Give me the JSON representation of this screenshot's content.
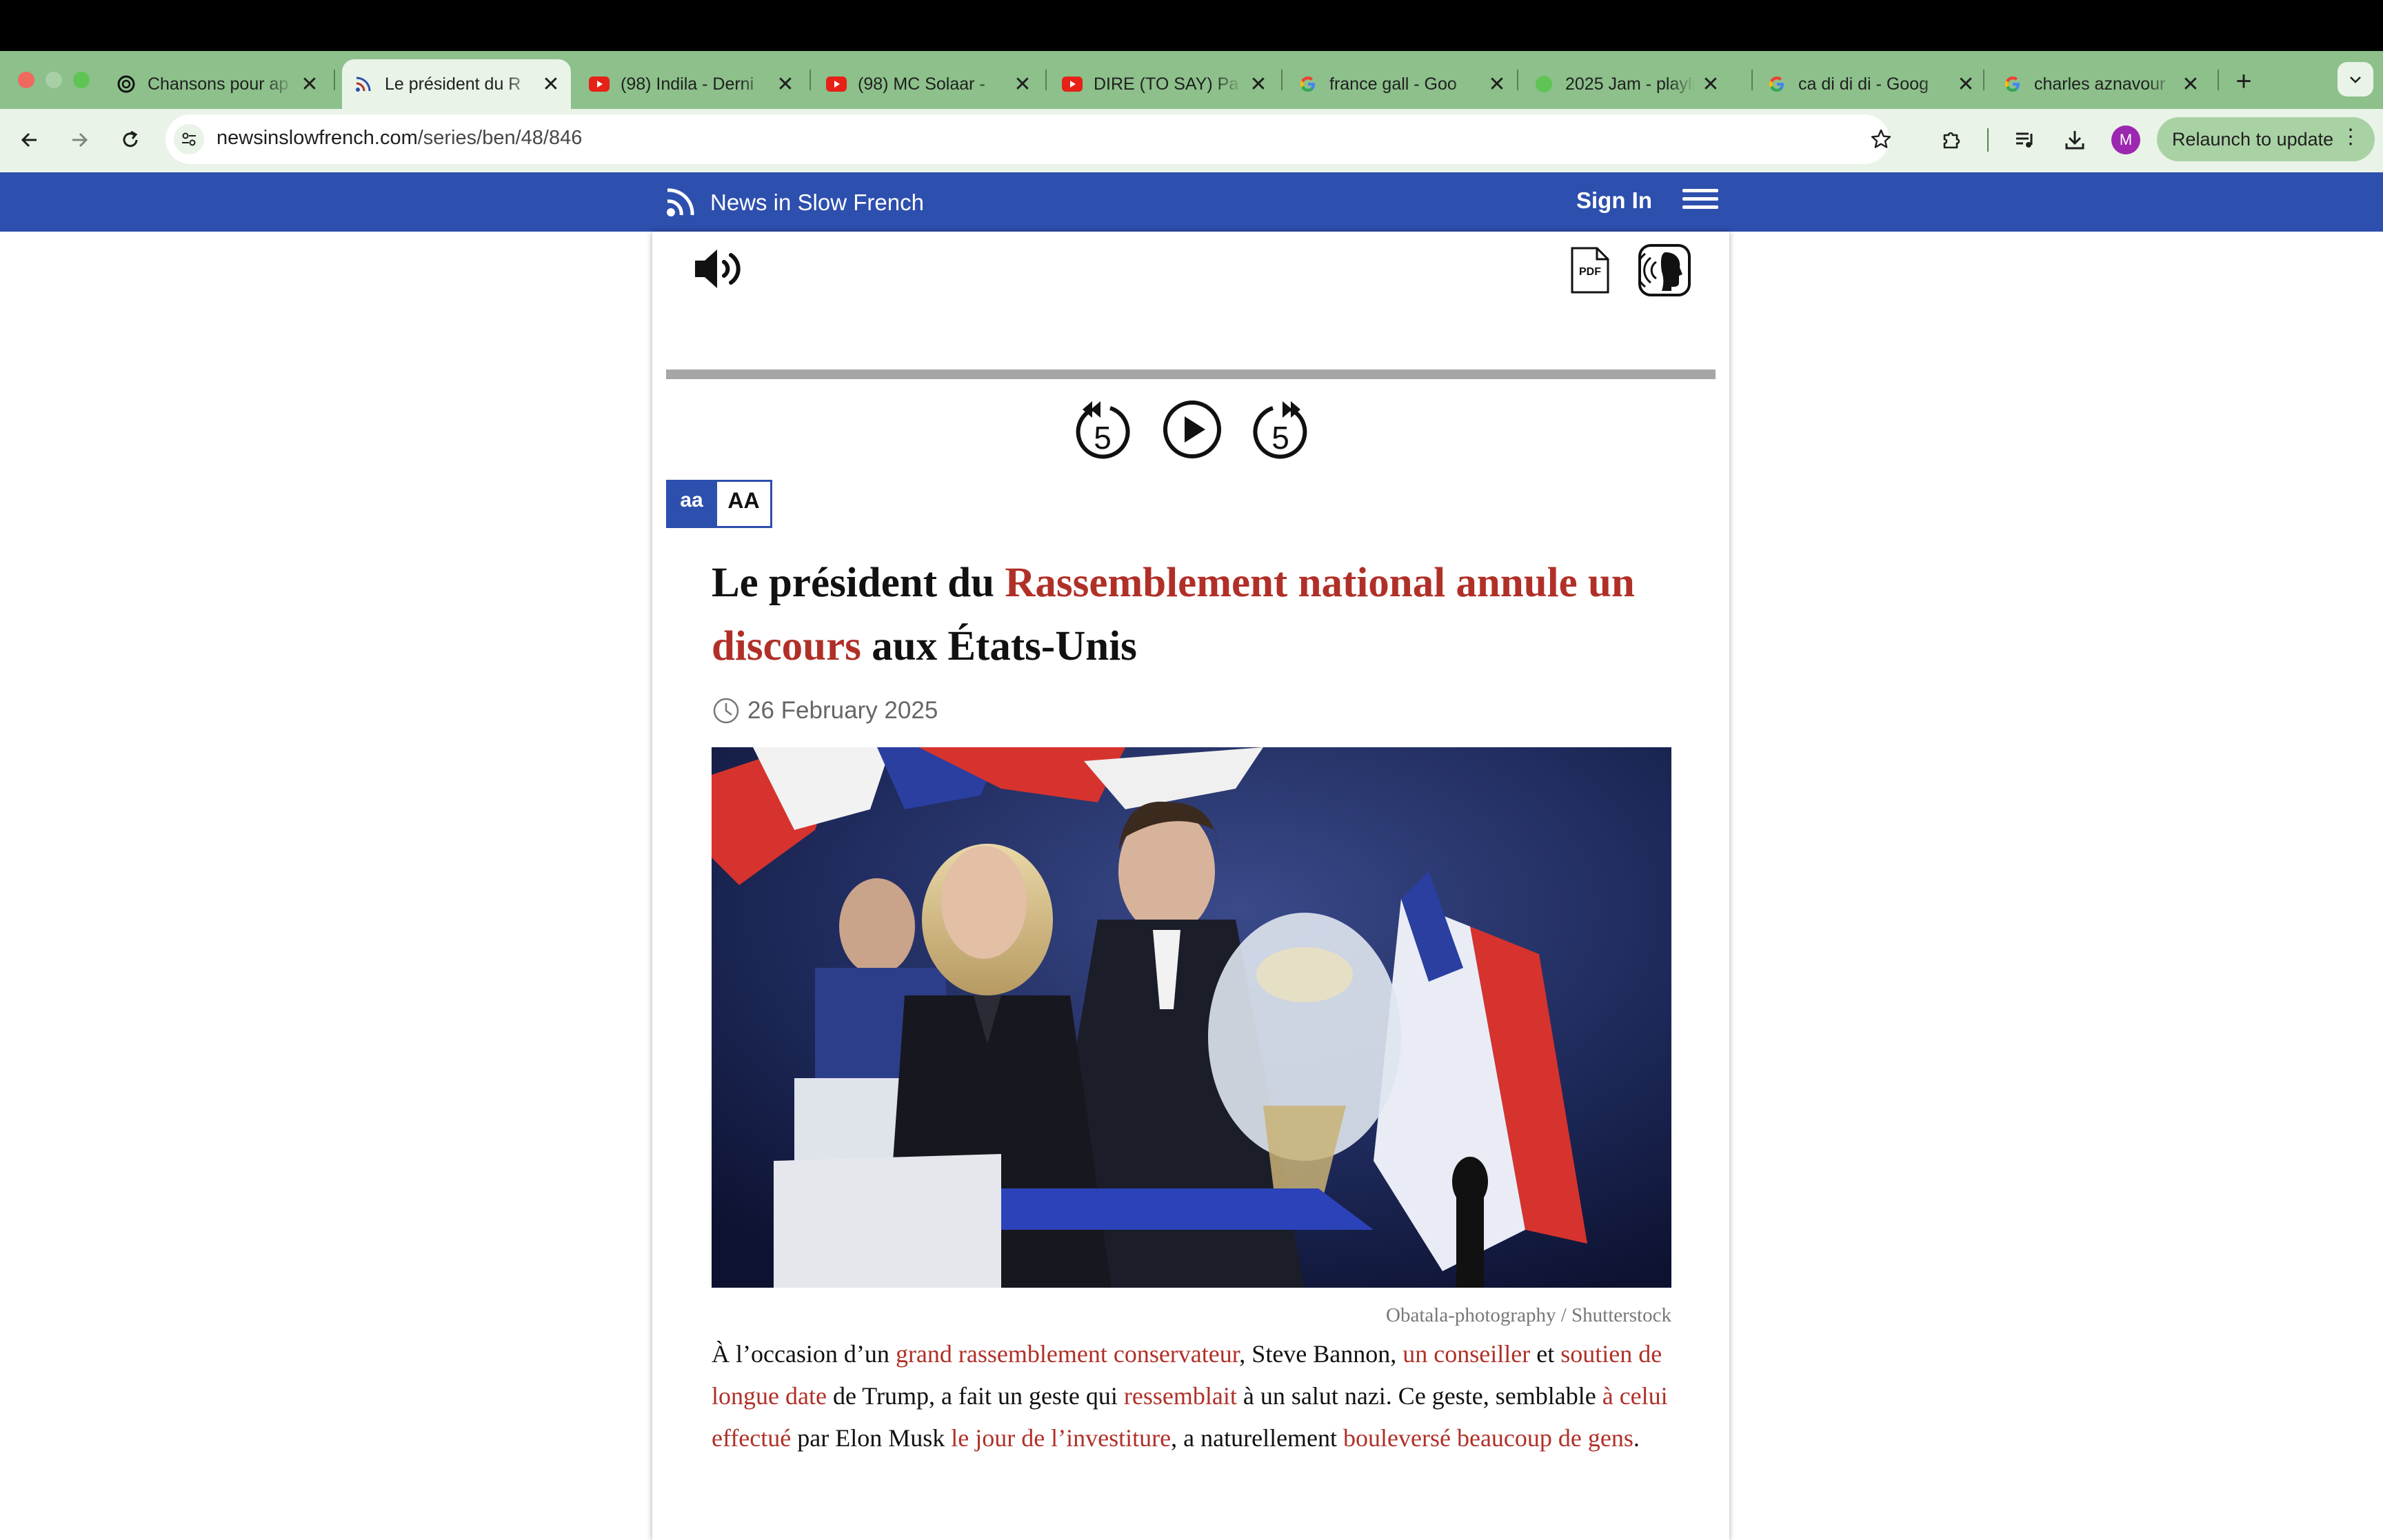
{
  "browser": {
    "tabs": [
      {
        "title": "Chansons pour ap",
        "icon": "chatgpt-icon"
      },
      {
        "title": "Le président du R",
        "icon": "newsinslowfrench-icon",
        "active": true
      },
      {
        "title": "(98) Indila - Derni",
        "icon": "youtube-icon"
      },
      {
        "title": "(98) MC Solaar - ",
        "icon": "youtube-icon"
      },
      {
        "title": "DIRE (TO SAY) Pa",
        "icon": "youtube-icon"
      },
      {
        "title": "france gall - Goo",
        "icon": "google-icon"
      },
      {
        "title": "2025 Jam - playli",
        "icon": "green-dot-icon"
      },
      {
        "title": "ca di di di - Goog",
        "icon": "google-icon"
      },
      {
        "title": "charles aznavour",
        "icon": "google-icon"
      }
    ],
    "tab_close_glyph": "✕",
    "new_tab_glyph": "+",
    "url_host": "newsinslowfrench.com",
    "url_path": "/series/ben/48/846",
    "profile_initial": "M",
    "relaunch_label": "Relaunch to update",
    "relaunch_menu_glyph": "⋮",
    "colors": {
      "tabstrip": "#8dc08b",
      "toolbar": "#e9f3e7"
    }
  },
  "site": {
    "logo_text": "News in Slow French",
    "sign_in_label": "Sign In",
    "header_color": "#2d4fad"
  },
  "player": {
    "pdf_label": "PDF",
    "rewind_seconds": "5",
    "forward_seconds": "5",
    "progress": 0
  },
  "font_size_toggle": {
    "small_label": "aa",
    "large_label": "AA"
  },
  "article": {
    "headline_parts": {
      "p1": "Le président du ",
      "p2": "Rassemblement national annule un discours",
      "p3": " aux États-Unis"
    },
    "date": "26 February 2025",
    "photo_credit": "Obatala-photography / Shutterstock",
    "body_parts": {
      "p1": "À l’occasion d’un ",
      "p2": "grand rassemblement conservateur",
      "p3": ", Steve Bannon, ",
      "p4": "un conseiller",
      "p5": " et ",
      "p6": "soutien de longue date",
      "p7": " de Trump, a fait un geste qui ",
      "p8": "ressemblait",
      "p9": " à un salut nazi. Ce geste, semblable ",
      "p10": "à celui effectué",
      "p11": " par Elon Musk ",
      "p12": "le jour de l’investiture",
      "p13": ", a naturellement ",
      "p14": "bouleversé beaucoup de gens",
      "p15": "."
    },
    "highlight_color": "#b03028"
  }
}
